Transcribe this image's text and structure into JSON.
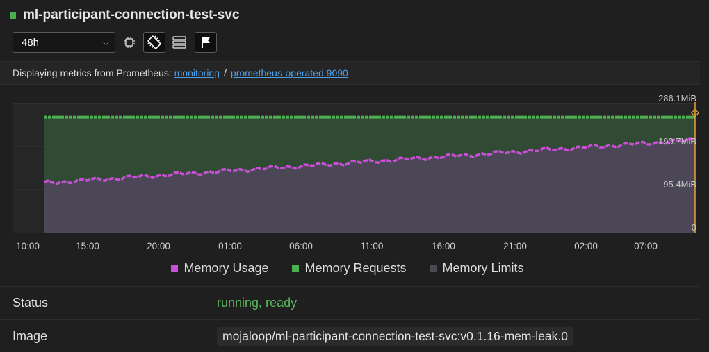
{
  "header": {
    "title": "ml-participant-connection-test-svc",
    "status_color": "#4caf50"
  },
  "toolbar": {
    "range_value": "48h",
    "buttons": [
      {
        "icon": "cpu-icon",
        "active": false
      },
      {
        "icon": "memory-chip-icon",
        "active": true
      },
      {
        "icon": "network-stack-icon",
        "active": false
      },
      {
        "icon": "flag-icon",
        "active": true
      }
    ]
  },
  "info": {
    "prefix": "Displaying metrics from Prometheus:",
    "namespace_link": "monitoring",
    "separator": "/",
    "service_link": "prometheus-operated:9090"
  },
  "chart_data": {
    "type": "area",
    "y_unit": "MiB",
    "y_ticks": [
      "286.1MiB",
      "190.7MiB",
      "95.4MiB",
      "0"
    ],
    "ylim": [
      0,
      286.1
    ],
    "x_ticks": [
      "10:00",
      "15:00",
      "20:00",
      "01:00",
      "06:00",
      "11:00",
      "16:00",
      "21:00",
      "02:00",
      "07:00"
    ],
    "series": [
      {
        "name": "Memory Usage",
        "color": "#c94fd6",
        "start": 110,
        "end": 205
      },
      {
        "name": "Memory Requests",
        "color": "#4caf50",
        "value": 256
      },
      {
        "name": "Memory Limits",
        "color": "#4a4a57",
        "value": 256
      }
    ]
  },
  "legend": [
    {
      "label": "Memory Usage",
      "color": "#c94fd6"
    },
    {
      "label": "Memory Requests",
      "color": "#4caf50"
    },
    {
      "label": "Memory Limits",
      "color": "#4a4a57"
    }
  ],
  "details": {
    "status_label": "Status",
    "status_value": "running, ready",
    "status_color": "#5cb85c",
    "image_label": "Image",
    "image_value": "mojaloop/ml-participant-connection-test-svc:v0.1.16-mem-leak.0"
  }
}
